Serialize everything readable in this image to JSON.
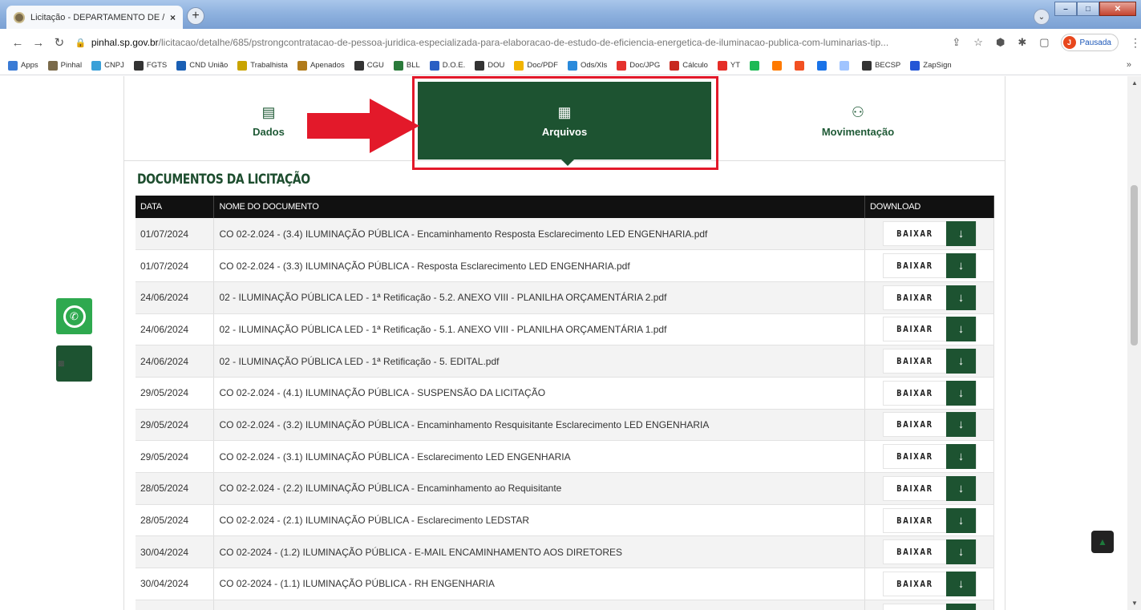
{
  "browser": {
    "tab_title": "Licitação - DEPARTAMENTO DE /",
    "tab_close": "×",
    "newtab": "+",
    "tabsearch": "⌄",
    "url_host": "pinhal.sp.gov.br",
    "url_path": "/licitacao/detalhe/685/pstrongcontratacao-de-pessoa-juridica-especializada-para-elaboracao-de-estudo-de-eficiencia-energetica-de-iluminacao-publica-com-luminarias-tip...",
    "profile_initial": "J",
    "profile_label": "Pausada",
    "window_minimize": "–",
    "window_maximize": "□",
    "window_close": "✕"
  },
  "bookmarks": [
    {
      "label": "Apps",
      "color": "#3a7bd5"
    },
    {
      "label": "Pinhal",
      "color": "#7a6a4a"
    },
    {
      "label": "CNPJ",
      "color": "#3aa0d8"
    },
    {
      "label": "FGTS",
      "color": "#333333"
    },
    {
      "label": "CND União",
      "color": "#1a5fb4"
    },
    {
      "label": "Trabalhista",
      "color": "#c9a400"
    },
    {
      "label": "Apenados",
      "color": "#b07a1a"
    },
    {
      "label": "CGU",
      "color": "#333333"
    },
    {
      "label": "BLL",
      "color": "#2a7a3a"
    },
    {
      "label": "D.O.E.",
      "color": "#2a5fc4"
    },
    {
      "label": "DOU",
      "color": "#333333"
    },
    {
      "label": "Doc/PDF",
      "color": "#f2b400"
    },
    {
      "label": "Ods/Xls",
      "color": "#2a8adb"
    },
    {
      "label": "Doc/JPG",
      "color": "#e5322d"
    },
    {
      "label": "Cálculo",
      "color": "#c8281e"
    },
    {
      "label": "YT",
      "color": "#e52d27"
    },
    {
      "label": "",
      "color": "#1db954"
    },
    {
      "label": "",
      "color": "#ff7a00"
    },
    {
      "label": "",
      "color": "#f25022"
    },
    {
      "label": "",
      "color": "#1a73e8"
    },
    {
      "label": "",
      "color": "#a0c4ff"
    },
    {
      "label": "BECSP",
      "color": "#333333"
    },
    {
      "label": "ZapSign",
      "color": "#2456d6"
    }
  ],
  "bookmarks_more": "»",
  "page": {
    "tabs": {
      "dados": "Dados",
      "arquivos": "Arquivos",
      "movimentacao": "Movimentação"
    },
    "section_title": "DOCUMENTOS DA LICITAÇÃO",
    "table_headers": {
      "date": "DATA",
      "name": "NOME DO DOCUMENTO",
      "download": "DOWNLOAD"
    },
    "download_label": "BAIXAR",
    "documents": [
      {
        "date": "01/07/2024",
        "name": "CO 02-2.024 - (3.4) ILUMINAÇÃO PÚBLICA - Encaminhamento Resposta Esclarecimento LED ENGENHARIA.pdf"
      },
      {
        "date": "01/07/2024",
        "name": "CO 02-2.024 - (3.3) ILUMINAÇÃO PÚBLICA - Resposta Esclarecimento LED ENGENHARIA.pdf"
      },
      {
        "date": "24/06/2024",
        "name": "02 - ILUMINAÇÃO PÚBLICA LED - 1ª Retificação - 5.2. ANEXO VIII - PLANILHA ORÇAMENTÁRIA 2.pdf"
      },
      {
        "date": "24/06/2024",
        "name": "02 - ILUMINAÇÃO PÚBLICA LED - 1ª Retificação - 5.1. ANEXO VIII - PLANILHA ORÇAMENTÁRIA 1.pdf"
      },
      {
        "date": "24/06/2024",
        "name": "02 - ILUMINAÇÃO PÚBLICA LED - 1ª Retificação - 5. EDITAL.pdf"
      },
      {
        "date": "29/05/2024",
        "name": "CO 02-2.024 - (4.1) ILUMINAÇÃO PÚBLICA - SUSPENSÃO DA LICITAÇÃO"
      },
      {
        "date": "29/05/2024",
        "name": "CO 02-2.024 - (3.2) ILUMINAÇÃO PÚBLICA - Encaminhamento Resquisitante Esclarecimento LED ENGENHARIA"
      },
      {
        "date": "29/05/2024",
        "name": "CO 02-2.024 - (3.1) ILUMINAÇÃO PÚBLICA - Esclarecimento LED ENGENHARIA"
      },
      {
        "date": "28/05/2024",
        "name": "CO 02-2.024 - (2.2) ILUMINAÇÃO PÚBLICA - Encaminhamento ao Requisitante"
      },
      {
        "date": "28/05/2024",
        "name": "CO 02-2.024 - (2.1) ILUMINAÇÃO PÚBLICA - Esclarecimento LEDSTAR"
      },
      {
        "date": "30/04/2024",
        "name": "CO 02-2024 - (1.2) ILUMINAÇÃO PÚBLICA - E-MAIL ENCAMINHAMENTO AOS DIRETORES"
      },
      {
        "date": "30/04/2024",
        "name": "CO 02-2024 - (1.1) ILUMINAÇÃO PÚBLICA - RH ENGENHARIA"
      },
      {
        "date": "",
        "name": ""
      }
    ]
  },
  "colors": {
    "brand_green": "#1d5331",
    "highlight_red": "#e3192a",
    "whatsapp_green": "#2ea94f"
  },
  "icons": {
    "dados": "document-icon",
    "arquivos": "file-icon",
    "movimentacao": "people-icon",
    "download": "arrow-down-icon"
  }
}
